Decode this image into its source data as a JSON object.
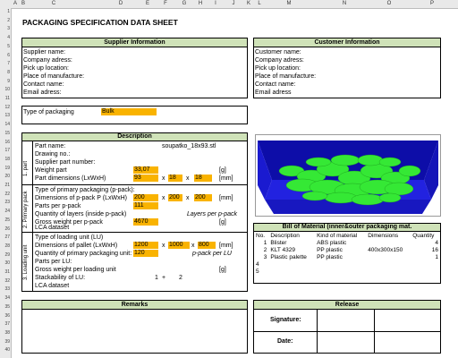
{
  "columns": [
    "A",
    "B",
    "C",
    "D",
    "E",
    "F",
    "G",
    "H",
    "I",
    "J",
    "K",
    "L",
    "M",
    "N",
    "O",
    "P"
  ],
  "rows": [
    "1",
    "2",
    "3",
    "4",
    "5",
    "6",
    "7",
    "8",
    "9",
    "10",
    "11",
    "12",
    "13",
    "14",
    "15",
    "16",
    "17",
    "18",
    "19",
    "20",
    "21",
    "22",
    "23",
    "24",
    "25",
    "26",
    "27",
    "28",
    "29",
    "30",
    "31",
    "32",
    "33",
    "34",
    "35",
    "36",
    "37",
    "38",
    "39",
    "40"
  ],
  "title": "PACKAGING SPECIFICATION DATA SHEET",
  "supplier": {
    "header": "Supplier Information",
    "fields": [
      "Supplier name:",
      "Company adress:",
      "Pick up location:",
      "Place of manufacture:",
      "Contact name:",
      "Email adress:"
    ]
  },
  "customer": {
    "header": "Customer Information",
    "fields": [
      "Customer name:",
      "Company adress:",
      "Pick up location:",
      "Place of manufacture:",
      "Contact name:",
      "Email adress"
    ]
  },
  "packaging_type": {
    "label": "Type of packaging",
    "value": "Bulk"
  },
  "description": {
    "header": "Description",
    "part_group": "1. part",
    "part_name_label": "Part name:",
    "part_name_value": "soupatko_18x93.stl",
    "drawing_label": "Drawing no.:",
    "supplier_part_label": "Supplier part number:",
    "weight_label": "Weight part",
    "weight_value": "33,07",
    "weight_unit": "[g]",
    "dims_label": "Part dimensions (LxWxH)",
    "dims": [
      "93",
      "18",
      "18"
    ],
    "dims_unit": "[mm]",
    "primary_group": "2. Primary pack",
    "prim_type_label": "Type of primary packaging (p-pack):",
    "prim_dims_label": "Dimensions of p-pack P (LxWxH)",
    "prim_dims": [
      "200",
      "200",
      "200"
    ],
    "prim_dims_unit": "[mm]",
    "parts_per_pack_label": "Parts per p-pack",
    "parts_per_pack_value": "111",
    "layers_label": "Quantity of layers (inside p-pack)",
    "layers_unit": "Layers per p-pack",
    "gross_pack_label": "Gross weight per p-pack",
    "gross_pack_value": "4670",
    "gross_pack_unit": "[g]",
    "lca_label": "LCA dataset",
    "loading_group": "3. Loading unit",
    "lu_type_label": "Type of loading unit (LU)",
    "pallet_dims_label": "Dimensions of pallet  (LxWxH)",
    "pallet_dims": [
      "1200",
      "1000",
      "800"
    ],
    "pallet_dims_unit": "[mm]",
    "qty_primary_label": "Quantity of primary packaging unit:",
    "qty_primary_value": "120",
    "qty_primary_unit": "p-pack per LU",
    "parts_per_lu_label": "Parts per LU:",
    "gross_lu_label": "Gross weight per loading unit",
    "gross_lu_unit": "[g]",
    "stack_label": "Stackability of LU:",
    "stack_a": "1",
    "stack_plus": "+",
    "stack_b": "2",
    "lca2_label": "LCA dataset",
    "x": "x"
  },
  "bom": {
    "header": "Bill of Material (inner&outer packaging mat.",
    "columns": [
      "No.",
      "Description",
      "Kind of material",
      "Dimensions",
      "Quantity"
    ],
    "rows": [
      {
        "no": "1",
        "desc": "Blister",
        "mat": "ABS plastic",
        "dim": "",
        "qty": "4"
      },
      {
        "no": "2",
        "desc": "KLT 4329",
        "mat": "PP plastic",
        "dim": "400x300x150",
        "qty": "16"
      },
      {
        "no": "3",
        "desc": "Plastic palette",
        "mat": "PP plastic",
        "dim": "",
        "qty": "1"
      },
      {
        "no": "4",
        "desc": "",
        "mat": "",
        "dim": "",
        "qty": ""
      },
      {
        "no": "5",
        "desc": "",
        "mat": "",
        "dim": "",
        "qty": ""
      }
    ]
  },
  "remarks": {
    "header": "Remarks"
  },
  "release": {
    "header": "Release",
    "signature_label": "Signature:",
    "date_label": "Date:"
  },
  "colors": {
    "header_green": "#cfe2b8",
    "input_orange": "#f9b300",
    "cell_gray": "#d9d9d9",
    "crate_blue": "#1c1cb4",
    "parts_green": "#2ee02e"
  }
}
